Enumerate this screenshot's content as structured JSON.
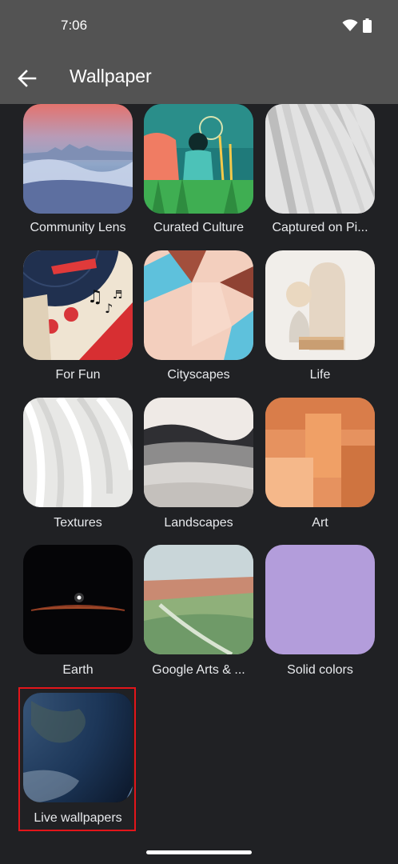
{
  "status_bar": {
    "time": "7:06",
    "wifi_icon": "wifi-icon",
    "battery_icon": "battery-icon"
  },
  "app_bar": {
    "back_icon": "arrow-back-icon",
    "title": "Wallpaper"
  },
  "categories": [
    {
      "label": "Community Lens"
    },
    {
      "label": "Curated Culture"
    },
    {
      "label": "Captured on Pi..."
    },
    {
      "label": "For Fun"
    },
    {
      "label": "Cityscapes"
    },
    {
      "label": "Life"
    },
    {
      "label": "Textures"
    },
    {
      "label": "Landscapes"
    },
    {
      "label": "Art"
    },
    {
      "label": "Earth"
    },
    {
      "label": "Google Arts & ..."
    },
    {
      "label": "Solid colors"
    },
    {
      "label": "Live wallpapers"
    }
  ],
  "highlight_color": "#e3151a"
}
